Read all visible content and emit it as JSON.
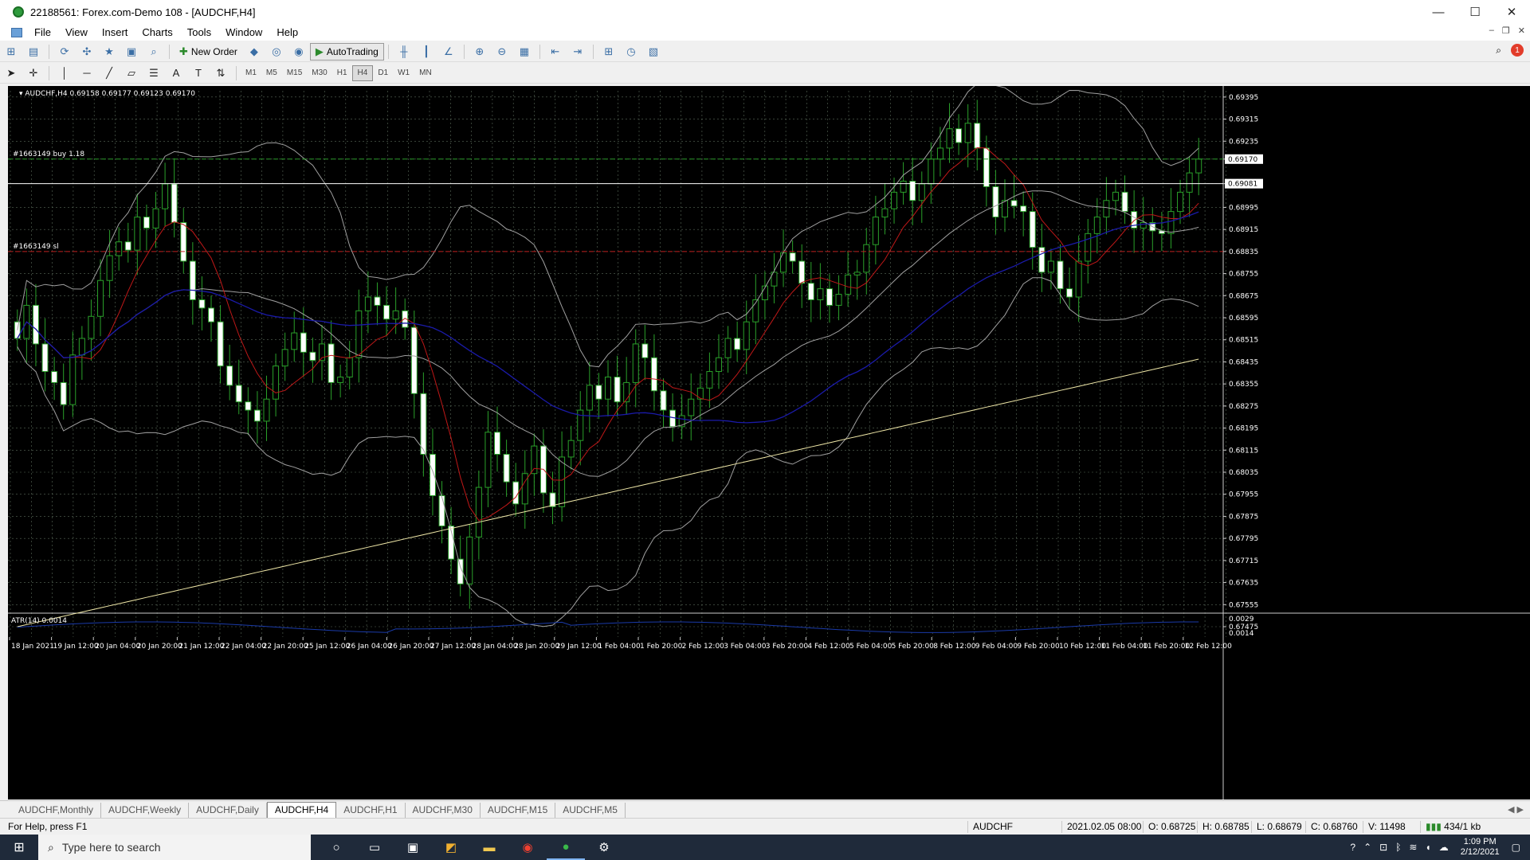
{
  "window": {
    "title": "22188561: Forex.com-Demo 108 - [AUDCHF,H4]",
    "controls": [
      "—",
      "☐",
      "✕"
    ]
  },
  "menu": [
    "File",
    "View",
    "Insert",
    "Charts",
    "Tools",
    "Window",
    "Help"
  ],
  "toolbar": {
    "new_order": "New Order",
    "autotrading": "AutoTrading",
    "timeframes": [
      "M1",
      "M5",
      "M15",
      "M30",
      "H1",
      "H4",
      "D1",
      "W1",
      "MN"
    ],
    "active_timeframe": "H4",
    "notification_count": "1"
  },
  "chart": {
    "info": "AUDCHF,H4  0.69158 0.69177 0.69123 0.69170",
    "order_buy_label": "#1663149 buy 1.18",
    "order_sl_label": "#1663149 sl",
    "current_price_label": "0.69170",
    "order_price_label": "0.69081",
    "atr_label": "ATR(14) 0.0014",
    "price_axis": [
      "0.69395",
      "0.69315",
      "0.69235",
      "0.69170",
      "0.69081",
      "0.68995",
      "0.68915",
      "0.68835",
      "0.68755",
      "0.68675",
      "0.68595",
      "0.68515",
      "0.68435",
      "0.68355",
      "0.68275",
      "0.68195",
      "0.68115",
      "0.68035",
      "0.67955",
      "0.67875",
      "0.67795",
      "0.67715",
      "0.67635",
      "0.67555",
      "0.67475"
    ],
    "atr_axis": [
      "0.0029",
      "0.0014"
    ],
    "time_axis": [
      "18 Jan 2021",
      "19 Jan 12:00",
      "20 Jan 04:00",
      "20 Jan 20:00",
      "21 Jan 12:00",
      "22 Jan 04:00",
      "22 Jan 20:00",
      "25 Jan 12:00",
      "26 Jan 04:00",
      "26 Jan 20:00",
      "27 Jan 12:00",
      "28 Jan 04:00",
      "28 Jan 20:00",
      "29 Jan 12:00",
      "1 Feb 04:00",
      "1 Feb 20:00",
      "2 Feb 12:00",
      "3 Feb 04:00",
      "3 Feb 20:00",
      "4 Feb 12:00",
      "5 Feb 04:00",
      "5 Feb 20:00",
      "8 Feb 12:00",
      "9 Feb 04:00",
      "9 Feb 20:00",
      "10 Feb 12:00",
      "11 Feb 04:00",
      "11 Feb 20:00",
      "12 Feb 12:00"
    ],
    "colors": {
      "background": "#000000",
      "grid": "#5a6a5a",
      "bull_candle": "#000000",
      "bear_candle": "#ffffff",
      "wick": "#2aa02a",
      "ma_fast": "#c01818",
      "ma_mid": "#1a1aa8",
      "ma_slow": "#f0e8a8",
      "bands": "#a0a0a0",
      "sl_line": "#c02020"
    }
  },
  "symbol_tabs": [
    "AUDCHF,Monthly",
    "AUDCHF,Weekly",
    "AUDCHF,Daily",
    "AUDCHF,H4",
    "AUDCHF,H1",
    "AUDCHF,M30",
    "AUDCHF,M15",
    "AUDCHF,M5"
  ],
  "active_tab": "AUDCHF,H4",
  "status": {
    "help": "For Help, press F1",
    "symbol": "AUDCHF",
    "datetime": "2021.02.05 08:00",
    "open": "O: 0.68725",
    "high": "H: 0.68785",
    "low": "L: 0.68679",
    "close": "C: 0.68760",
    "volume": "V: 11498",
    "traffic": "434/1 kb"
  },
  "taskbar": {
    "search_placeholder": "Type here to search",
    "time": "1:09 PM",
    "date": "2/12/2021"
  }
}
